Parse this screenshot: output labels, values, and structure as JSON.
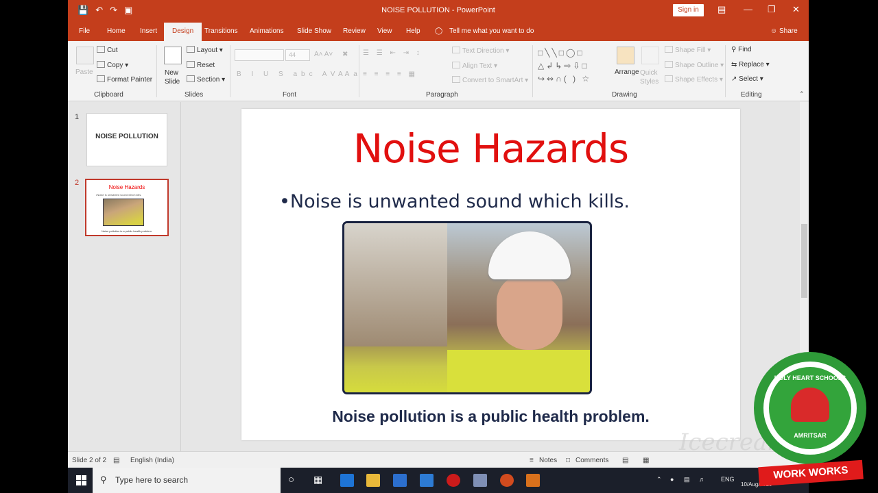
{
  "titlebar": {
    "title": "NOISE POLLUTION  -  PowerPoint",
    "signin": "Sign in",
    "qat_icons": [
      "save-icon",
      "undo-icon",
      "redo-icon",
      "start-slideshow-icon"
    ]
  },
  "tabs": [
    "File",
    "Home",
    "Insert",
    "Design",
    "Transitions",
    "Animations",
    "Slide Show",
    "Review",
    "View",
    "Help"
  ],
  "tell_me": "Tell me what you want to do",
  "share": "Share",
  "ribbon": {
    "clipboard": {
      "paste": "Paste",
      "cut": "Cut",
      "copy": "Copy",
      "format_painter": "Format Painter",
      "label": "Clipboard"
    },
    "slides": {
      "new_slide": "New Slide",
      "layout": "Layout",
      "reset": "Reset",
      "section": "Section",
      "label": "Slides"
    },
    "font": {
      "size": "44",
      "label": "Font"
    },
    "paragraph": {
      "text_direction": "Text Direction",
      "align_text": "Align Text",
      "convert_smartart": "Convert to SmartArt",
      "label": "Paragraph"
    },
    "drawing": {
      "arrange": "Arrange",
      "quick_styles": "Quick Styles",
      "shape_fill": "Shape Fill",
      "shape_outline": "Shape Outline",
      "shape_effects": "Shape Effects",
      "label": "Drawing"
    },
    "editing": {
      "find": "Find",
      "replace": "Replace",
      "select": "Select",
      "label": "Editing"
    }
  },
  "thumbnails": [
    {
      "num": "1",
      "title": "NOISE POLLUTION"
    },
    {
      "num": "2",
      "title": "Noise Hazards",
      "bullet": "•Noise is unwanted sound which kills.",
      "caption": "Noise pollution is a public health problem."
    }
  ],
  "slide": {
    "title": "Noise Hazards",
    "bullet": "•Noise is unwanted sound which kills.",
    "caption": "Noise pollution is a public health problem.",
    "title_color": "#e1100f"
  },
  "status": {
    "slide_of": "Slide 2 of 2",
    "language": "English (India)",
    "notes": "Notes",
    "comments": "Comments"
  },
  "taskbar": {
    "search_placeholder": "Type here to search",
    "lang": "ENG",
    "date": "10/Aug/2020"
  },
  "badge": {
    "top_text": "HOLY HEART SCHOOLS",
    "bottom_text": "AMRITSAR",
    "ribbon_text": "WORK WORKS"
  },
  "colors": {
    "accent": "#c43e1c"
  }
}
